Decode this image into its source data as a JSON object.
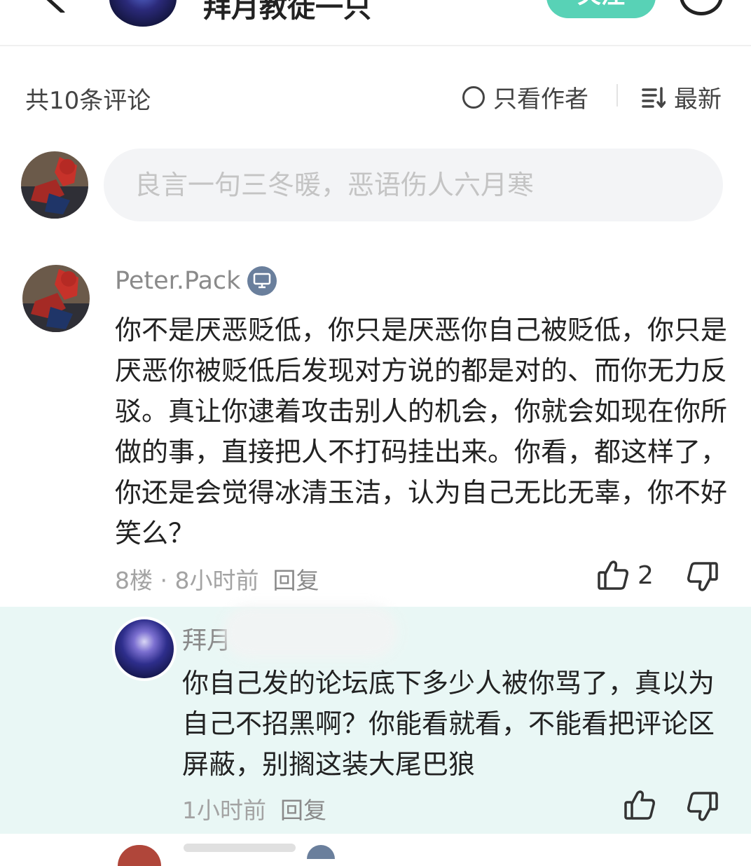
{
  "topbar": {
    "title": "拜月教徒一只",
    "follow_label": "关注"
  },
  "comments_header": {
    "count_label": "共10条评论",
    "author_only_label": "只看作者",
    "sort_label": "最新"
  },
  "composer": {
    "placeholder": "良言一句三冬暖，恶语伤人六月寒"
  },
  "comment": {
    "username": "Peter.Pack",
    "text": "你不是厌恶贬低，你只是厌恶你自己被贬低，你只是厌恶你被贬低后发现对方说的都是对的、而你无力反驳。真让你逮着攻击别人的机会，你就会如现在你所做的事，直接把人不打码挂出来。你看，都这样了，你还是会觉得冰清玉洁，认为自己无比无辜，你不好笑么？",
    "floor_time": "8楼 · 8小时前",
    "reply_label": "回复",
    "like_count": "2"
  },
  "reply": {
    "username": "拜月",
    "text": "你自己发的论坛底下多少人被你骂了，真以为自己不招黑啊？你能看就看，不能看把评论区屏蔽，别搁这装大尾巴狼",
    "time": "1小时前",
    "reply_label": "回复"
  },
  "colors": {
    "accent": "#58d2b6",
    "reply_bg": "#e9f7f5",
    "input_bg": "#f3f4f6",
    "muted_text": "#a3a3a3"
  },
  "icons": {
    "back": "chevron-left-icon",
    "more": "circle-more-icon",
    "sort": "sort-list-icon",
    "badge": "computer-badge-icon",
    "like": "thumbs-up-icon",
    "dislike": "thumbs-down-icon"
  }
}
